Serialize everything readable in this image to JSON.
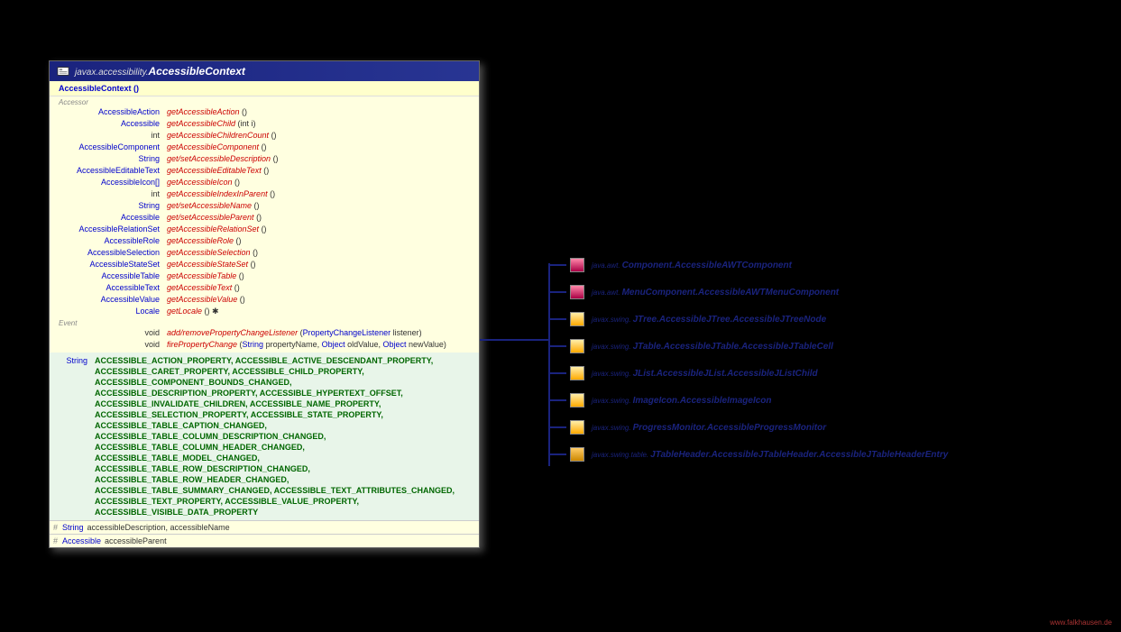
{
  "footer": "www.falkhausen.de",
  "header": {
    "package": "javax.accessibility.",
    "class": "AccessibleContext"
  },
  "constructor": "AccessibleContext ()",
  "sections": {
    "accessor": "Accessor",
    "event": "Event"
  },
  "accessors": [
    {
      "ret": "AccessibleAction",
      "name": "getAccessibleAction",
      "params": "()"
    },
    {
      "ret": "Accessible",
      "name": "getAccessibleChild",
      "params": "(int i)"
    },
    {
      "ret": "int",
      "primitive": true,
      "name": "getAccessibleChildrenCount",
      "params": "()"
    },
    {
      "ret": "AccessibleComponent",
      "name": "getAccessibleComponent",
      "params": "()"
    },
    {
      "ret": "String",
      "getset": true,
      "name": "get/setAccessibleDescription",
      "params": "()"
    },
    {
      "ret": "AccessibleEditableText",
      "name": "getAccessibleEditableText",
      "params": "()"
    },
    {
      "ret": "AccessibleIcon[]",
      "name": "getAccessibleIcon",
      "params": "()"
    },
    {
      "ret": "int",
      "primitive": true,
      "name": "getAccessibleIndexInParent",
      "params": "()"
    },
    {
      "ret": "String",
      "getset": true,
      "name": "get/setAccessibleName",
      "params": "()"
    },
    {
      "ret": "Accessible",
      "getset": true,
      "name": "get/setAccessibleParent",
      "params": "()"
    },
    {
      "ret": "AccessibleRelationSet",
      "name": "getAccessibleRelationSet",
      "params": "()"
    },
    {
      "ret": "AccessibleRole",
      "name": "getAccessibleRole",
      "params": "()"
    },
    {
      "ret": "AccessibleSelection",
      "name": "getAccessibleSelection",
      "params": "()"
    },
    {
      "ret": "AccessibleStateSet",
      "name": "getAccessibleStateSet",
      "params": "()"
    },
    {
      "ret": "AccessibleTable",
      "name": "getAccessibleTable",
      "params": "()"
    },
    {
      "ret": "AccessibleText",
      "name": "getAccessibleText",
      "params": "()"
    },
    {
      "ret": "AccessibleValue",
      "name": "getAccessibleValue",
      "params": "()"
    },
    {
      "ret": "Locale",
      "name": "getLocale",
      "params": "() ✱"
    }
  ],
  "events": [
    {
      "ret": "void",
      "primitive": true,
      "addrem": true,
      "name": "add/removePropertyChangeListener",
      "paramsraw": "(PropertyChangeListener listener)"
    },
    {
      "ret": "void",
      "primitive": true,
      "name": "firePropertyChange",
      "paramsraw": "(String propertyName, Object oldValue, Object newValue)"
    }
  ],
  "constants_type": "String",
  "constants": "ACCESSIBLE_ACTION_PROPERTY, ACCESSIBLE_ACTIVE_DESCENDANT_PROPERTY, ACCESSIBLE_CARET_PROPERTY, ACCESSIBLE_CHILD_PROPERTY, ACCESSIBLE_COMPONENT_BOUNDS_CHANGED, ACCESSIBLE_DESCRIPTION_PROPERTY, ACCESSIBLE_HYPERTEXT_OFFSET, ACCESSIBLE_INVALIDATE_CHILDREN, ACCESSIBLE_NAME_PROPERTY, ACCESSIBLE_SELECTION_PROPERTY, ACCESSIBLE_STATE_PROPERTY, ACCESSIBLE_TABLE_CAPTION_CHANGED, ACCESSIBLE_TABLE_COLUMN_DESCRIPTION_CHANGED, ACCESSIBLE_TABLE_COLUMN_HEADER_CHANGED, ACCESSIBLE_TABLE_MODEL_CHANGED, ACCESSIBLE_TABLE_ROW_DESCRIPTION_CHANGED, ACCESSIBLE_TABLE_ROW_HEADER_CHANGED, ACCESSIBLE_TABLE_SUMMARY_CHANGED, ACCESSIBLE_TEXT_ATTRIBUTES_CHANGED, ACCESSIBLE_TEXT_PROPERTY, ACCESSIBLE_VALUE_PROPERTY, ACCESSIBLE_VISIBLE_DATA_PROPERTY",
  "protected": [
    {
      "type": "String",
      "name": "accessibleDescription, accessibleName"
    },
    {
      "type": "Accessible",
      "name": "accessibleParent"
    }
  ],
  "subclasses": [
    {
      "icon": "component",
      "pkg": "java.awt.",
      "name": "Component.AccessibleAWTComponent"
    },
    {
      "icon": "component",
      "pkg": "java.awt.",
      "name": "MenuComponent.AccessibleAWTMenuComponent"
    },
    {
      "icon": "swing",
      "pkg": "javax.swing.",
      "name": "JTree.AccessibleJTree.AccessibleJTreeNode"
    },
    {
      "icon": "swing",
      "pkg": "javax.swing.",
      "name": "JTable.AccessibleJTable.AccessibleJTableCell"
    },
    {
      "icon": "swing",
      "pkg": "javax.swing.",
      "name": "JList.AccessibleJList.AccessibleJListChild"
    },
    {
      "icon": "swing",
      "pkg": "javax.swing.",
      "name": "ImageIcon.AccessibleImageIcon"
    },
    {
      "icon": "swing",
      "pkg": "javax.swing.",
      "name": "ProgressMonitor.AccessibleProgressMonitor"
    },
    {
      "icon": "table",
      "pkg": "javax.swing.table.",
      "name": "JTableHeader.AccessibleJTableHeader.AccessibleJTableHeaderEntry"
    }
  ]
}
